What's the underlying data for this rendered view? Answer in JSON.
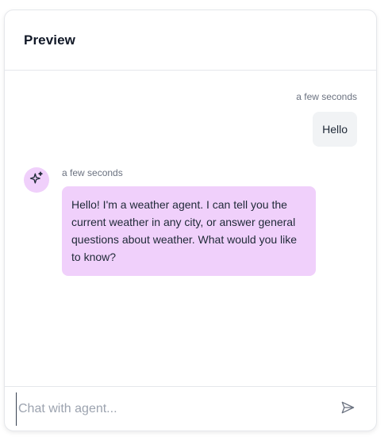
{
  "header": {
    "title": "Preview"
  },
  "messages": [
    {
      "role": "user",
      "timestamp": "a few seconds",
      "text": "Hello"
    },
    {
      "role": "agent",
      "avatar_icon": "sparkles-icon",
      "timestamp": "a few seconds",
      "text": "Hello! I'm a weather agent. I can tell you the current weather in any city, or answer general questions about weather. What would you like to know?"
    }
  ],
  "composer": {
    "placeholder": "Chat with agent...",
    "value": "",
    "send_icon": "send-icon"
  },
  "colors": {
    "agent_bubble": "#f0d0fb",
    "user_bubble": "#f1f3f5",
    "border": "#e5e7eb"
  }
}
